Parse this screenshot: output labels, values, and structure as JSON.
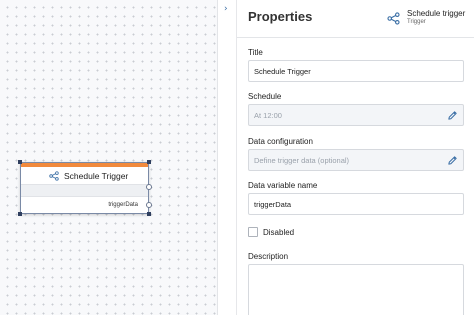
{
  "canvas": {
    "node": {
      "title": "Schedule Trigger",
      "output_label": "triggerData",
      "accent_color": "#f18a3d",
      "icon": "trigger-icon"
    }
  },
  "collapse": {
    "icon": "chevron-right-icon",
    "glyph": "›"
  },
  "properties": {
    "heading": "Properties",
    "node_type": {
      "name": "Schedule trigger",
      "sub": "Trigger",
      "icon": "trigger-icon"
    },
    "title_label": "Title",
    "title_value": "Schedule Trigger",
    "schedule_label": "Schedule",
    "schedule_value": "At 12:00",
    "data_config_label": "Data configuration",
    "data_config_placeholder": "Define trigger data (optional)",
    "data_variable_label": "Data variable name",
    "data_variable_value": "triggerData",
    "disabled_label": "Disabled",
    "description_label": "Description",
    "edit_icon": "pencil-icon",
    "accent_color": "#3a6ea5"
  }
}
